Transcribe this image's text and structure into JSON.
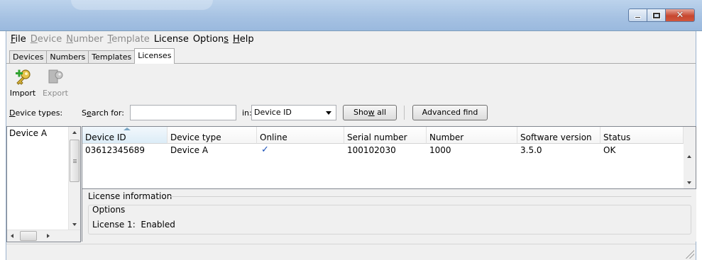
{
  "menu": [
    {
      "label": "File",
      "mnemonic_index": 0,
      "disabled": false
    },
    {
      "label": "Device",
      "mnemonic_index": 0,
      "disabled": true
    },
    {
      "label": "Number",
      "mnemonic_index": 0,
      "disabled": true
    },
    {
      "label": "Template",
      "mnemonic_index": 0,
      "disabled": true
    },
    {
      "label": "License",
      "mnemonic_index": -1,
      "disabled": false
    },
    {
      "label": "Options",
      "mnemonic_index": 6,
      "disabled": false
    },
    {
      "label": "Help",
      "mnemonic_index": 0,
      "disabled": false
    }
  ],
  "tabs": [
    "Devices",
    "Numbers",
    "Templates",
    "Licenses"
  ],
  "active_tab": "Licenses",
  "toolbar": {
    "import_label": "Import",
    "export_label": "Export"
  },
  "search": {
    "device_types_label": "Device types:",
    "search_for_label": "Search for:",
    "search_value": "",
    "in_label": "in:",
    "in_value": "Device ID",
    "show_all_label": "Show all",
    "advanced_find_label": "Advanced find"
  },
  "device_types": [
    "Device A"
  ],
  "grid": {
    "columns": [
      "Device ID",
      "Device type",
      "Online",
      "Serial number",
      "Number",
      "Software version",
      "Status"
    ],
    "rows": [
      {
        "device_id": "03612345689",
        "device_type": "Device A",
        "online": "✓",
        "serial_number": "100102030",
        "number": "1000",
        "software_version": "3.5.0",
        "status": "OK"
      }
    ]
  },
  "license_info": {
    "title": "License information",
    "options_title": "Options",
    "lines": [
      {
        "label": "License 1:",
        "value": "Enabled"
      }
    ]
  },
  "colors": {
    "checkmark": "#1a50b8",
    "close_button": "#c7472f",
    "titlebar": "#a5c1e2"
  }
}
